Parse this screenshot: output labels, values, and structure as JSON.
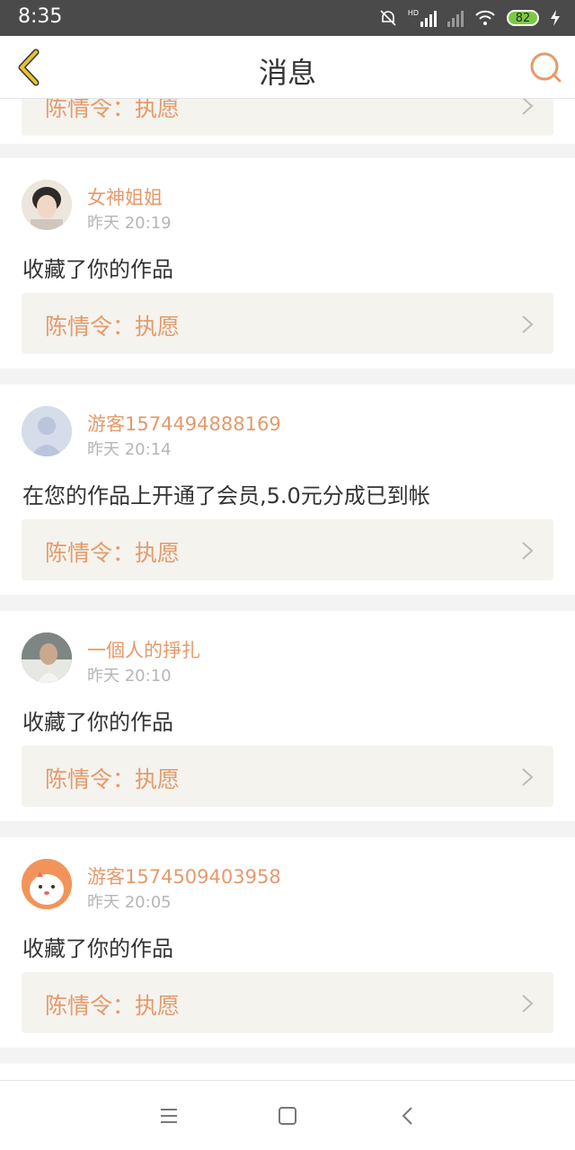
{
  "status_bar": {
    "time": "8:35",
    "battery": "82",
    "network": "HD"
  },
  "header": {
    "title": "消息",
    "back_icon": "chevron-left-icon",
    "chat_icon": "chat-bubble-icon"
  },
  "messages": [
    {
      "work_title": "陈情令：执愿"
    },
    {
      "user": "女神姐姐",
      "time": "昨天 20:19",
      "text": "收藏了你的作品",
      "work_title": "陈情令：执愿"
    },
    {
      "user": "游客1574494888169",
      "time": "昨天 20:14",
      "text": "在您的作品上开通了会员,5.0元分成已到帐",
      "work_title": "陈情令：执愿"
    },
    {
      "user": "一個人的掙扎",
      "time": "昨天 20:10",
      "text": "收藏了你的作品",
      "work_title": "陈情令：执愿"
    },
    {
      "user": "游客1574509403958",
      "time": "昨天 20:05",
      "text": "收藏了你的作品",
      "work_title": "陈情令：执愿"
    }
  ],
  "colors": {
    "accent": "#e59a6b",
    "header_back": "#e8c22e",
    "card_bg": "#f4f3ee"
  },
  "nav": {
    "menu_icon": "menu-icon",
    "home_icon": "home-square-icon",
    "back_icon": "back-triangle-icon"
  }
}
